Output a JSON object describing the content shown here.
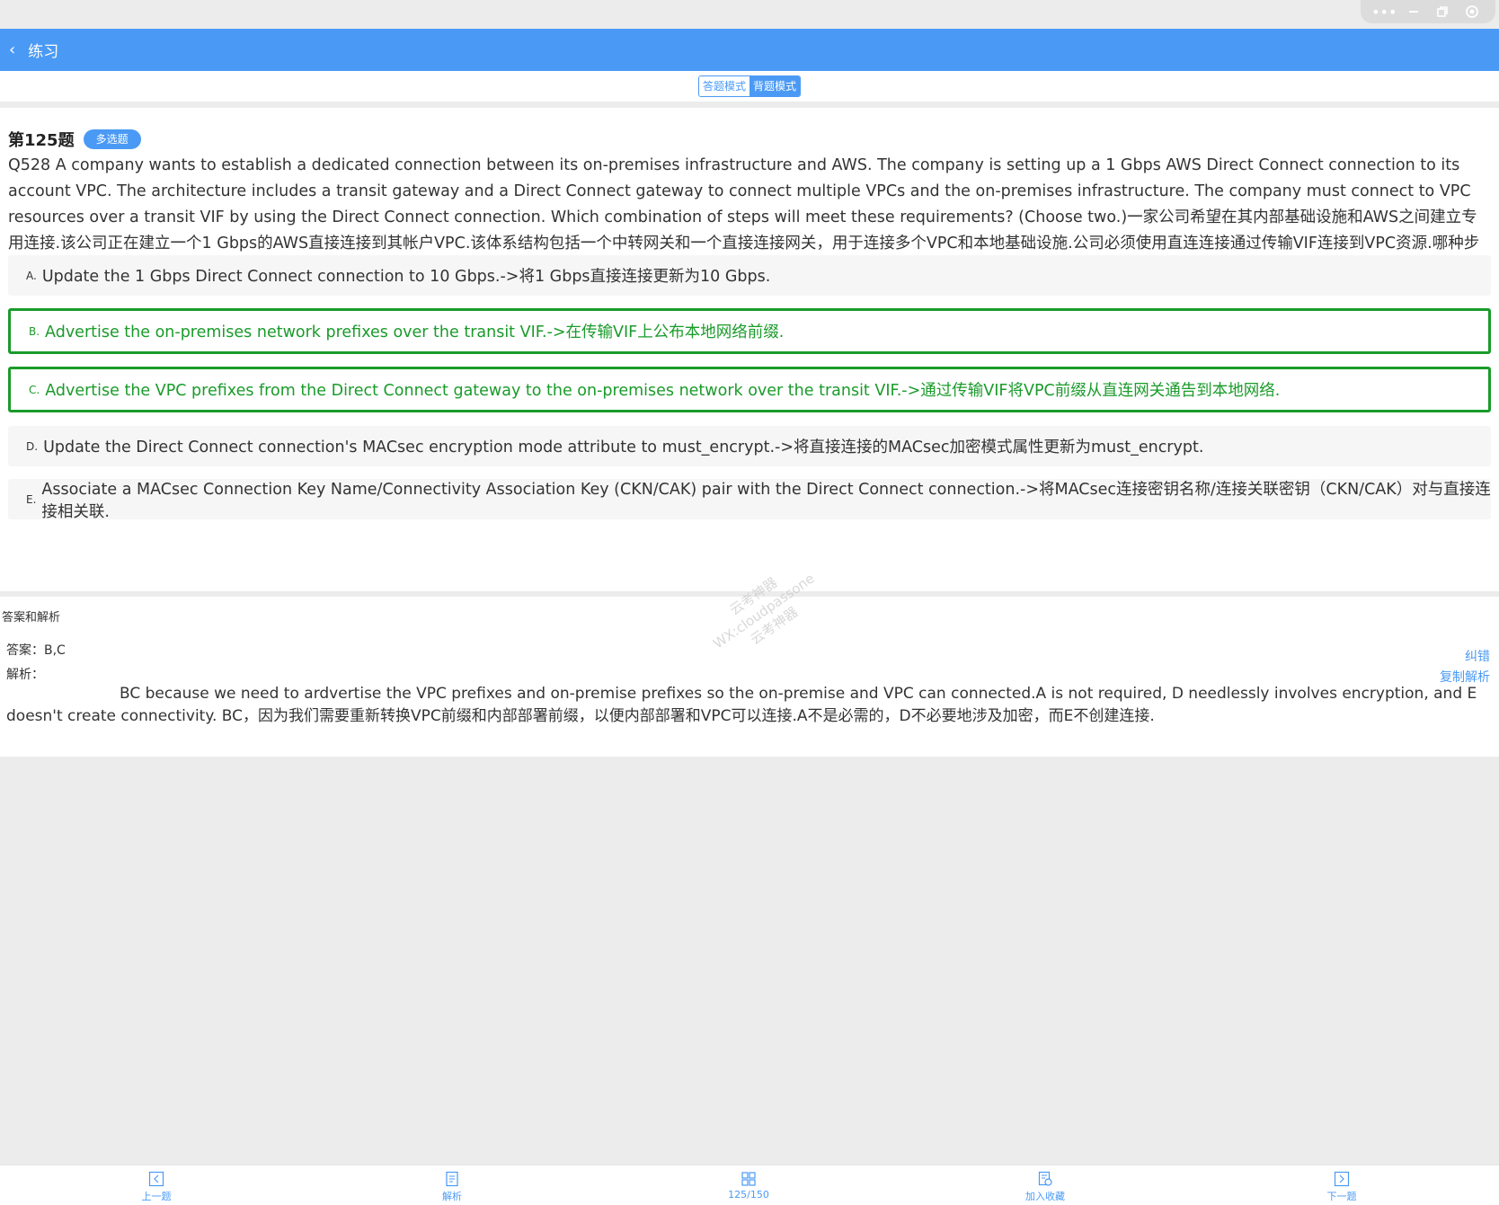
{
  "window": {
    "controls": [
      "more-icon",
      "minimize-icon",
      "restore-icon",
      "close-icon"
    ]
  },
  "header": {
    "title": "练习"
  },
  "modes": {
    "answer": "答题模式",
    "memorize": "背题模式"
  },
  "question": {
    "number": "第125题",
    "type": "多选题",
    "text": "Q528 A company wants to establish a dedicated connection between its on-premises infrastructure and AWS. The company is setting up a 1 Gbps AWS Direct Connect connection to its account VPC. The architecture includes a transit gateway and a Direct Connect gateway to connect multiple VPCs and the on-premises infrastructure. The company must connect to VPC resources over a transit VIF by using the Direct Connect connection. Which combination of steps will meet these requirements? (Choose two.)一家公司希望在其内部基础设施和AWS之间建立专用连接.该公司正在建立一个1 Gbps的AWS直接连接到其帐户VPC.该体系结构包括一个中转网关和一个直接连接网关，用于连接多个VPC和本地基础设施.公司必须使用直连连接通过传输VIF连接到VPC资源.哪种步骤组合将满足这些要求？ （选择两个.）",
    "options": [
      {
        "letter": "A.",
        "text": "Update the 1 Gbps Direct Connect connection to 10 Gbps.->将1 Gbps直接连接更新为10 Gbps."
      },
      {
        "letter": "B.",
        "text": "Advertise the on-premises network prefixes over the transit VIF.->在传输VIF上公布本地网络前缀."
      },
      {
        "letter": "C.",
        "text": "Advertise the VPC prefixes from the Direct Connect gateway to the on-premises network over the transit VIF.->通过传输VIF将VPC前缀从直连网关通告到本地网络."
      },
      {
        "letter": "D.",
        "text": "Update the Direct Connect connection's MACsec encryption mode attribute to must_encrypt.->将直接连接的MACsec加密模式属性更新为must_encrypt."
      },
      {
        "letter": "E.",
        "text": "Associate a MACsec Connection Key Name/Connectivity Association Key (CKN/CAK) pair with the Direct Connect connection.->将MACsec连接密钥名称/连接关联密钥（CKN/CAK）对与直接连接相关联."
      }
    ]
  },
  "analysis": {
    "title": "答案和解析",
    "answer": "答案：B,C",
    "label": "解析：",
    "text": "BC because we need to ardvertise the VPC prefixes and on-premise prefixes so the on-premise and VPC can connected.A is not required, D needlessly involves encryption, and E doesn't create connectivity. BC，因为我们需要重新转换VPC前缀和内部部署前缀，以便内部部署和VPC可以连接.A不是必需的，D不必要地涉及加密，而E不创建连接.",
    "report_link": "纠错",
    "copy_link": "复制解析"
  },
  "watermark": {
    "line1": "云考神器",
    "line2": "WX:cloudpassone",
    "line3": "云考神器"
  },
  "bottom_nav": {
    "prev": "上一题",
    "analysis": "解析",
    "progress": "125/150",
    "favorite": "加入收藏",
    "next": "下一题"
  },
  "colors": {
    "accent": "#4a9af5",
    "correct": "#1a9b2a"
  }
}
